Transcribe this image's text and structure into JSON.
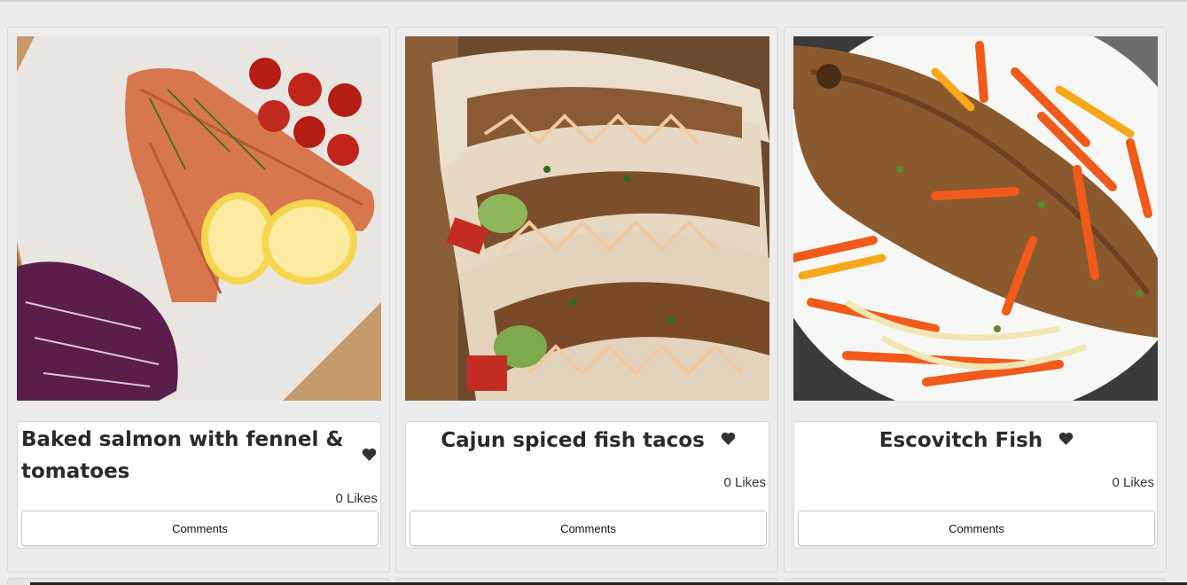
{
  "recipes": [
    {
      "title": "Baked salmon with fennel & tomatoes",
      "likes": "0 Likes",
      "comments_label": "Comments",
      "image_alt": "Baked salmon fillets with lemon halves, cherry tomatoes and red cabbage slaw"
    },
    {
      "title": "Cajun spiced fish tacos",
      "likes": "0 Likes",
      "comments_label": "Comments",
      "image_alt": "Cajun spiced fish tacos with guacamole and creamy drizzle"
    },
    {
      "title": "Escovitch Fish",
      "likes": "0 Likes",
      "comments_label": "Comments",
      "image_alt": "Fried fish topped with pickled carrots, peppers and onions"
    }
  ],
  "colors": {
    "page_background": "#ececec",
    "heart": "#333333",
    "title_text": "#2a2a2a"
  },
  "icons": {
    "like": "heart-icon"
  }
}
